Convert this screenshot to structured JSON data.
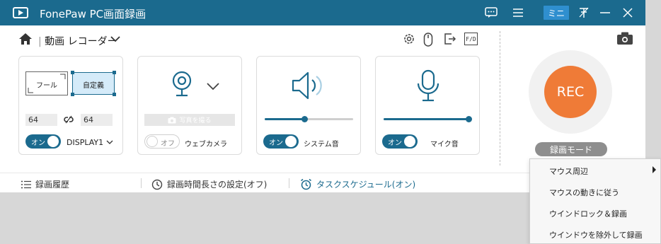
{
  "titlebar": {
    "title": "FonePaw PC画面録画",
    "mini_label": "ミニ",
    "icons": [
      "app-logo-icon",
      "feedback-icon",
      "menu-icon",
      "pin-icon",
      "minimize-icon",
      "close-icon"
    ]
  },
  "toolbar": {
    "mode_label": "動画 レコーダー",
    "icons": [
      "home-icon",
      "settings-icon",
      "mouse-icon",
      "export-icon",
      "fps-icon"
    ],
    "fps_label": "F/D"
  },
  "area_card": {
    "full_label": "フール",
    "custom_label": "自定義",
    "width_value": "64",
    "height_value": "64",
    "toggle_label": "オン",
    "display_label": "DISPLAY1"
  },
  "webcam_card": {
    "photo_button_label": "写真を撮る",
    "toggle_label": "オフ",
    "label": "ウェブカメラ"
  },
  "system_audio_card": {
    "toggle_label": "オン",
    "label": "システム音",
    "volume": 0.45
  },
  "mic_card": {
    "toggle_label": "オン",
    "label": "マイク音",
    "volume": 1.0
  },
  "rec": {
    "label": "REC",
    "mode_label": "録画モード"
  },
  "footer": {
    "history_label": "録画履歴",
    "duration_label": "録画時間長さの設定(オフ)",
    "schedule_label": "タスクスケジュール(オン)"
  },
  "context_menu": {
    "items": [
      {
        "label": "マウス周辺",
        "has_submenu": true
      },
      {
        "label": "マウスの動きに従う",
        "has_submenu": false
      },
      {
        "label": "ウインドロック＆録画",
        "has_submenu": false
      },
      {
        "label": "ウインドウを除外して録画",
        "has_submenu": false
      }
    ]
  },
  "colors": {
    "titlebar": "#1b6a8e",
    "accent": "#1b6a8e",
    "rec": "#ef7b37",
    "mini_button": "#2f8fcf"
  }
}
